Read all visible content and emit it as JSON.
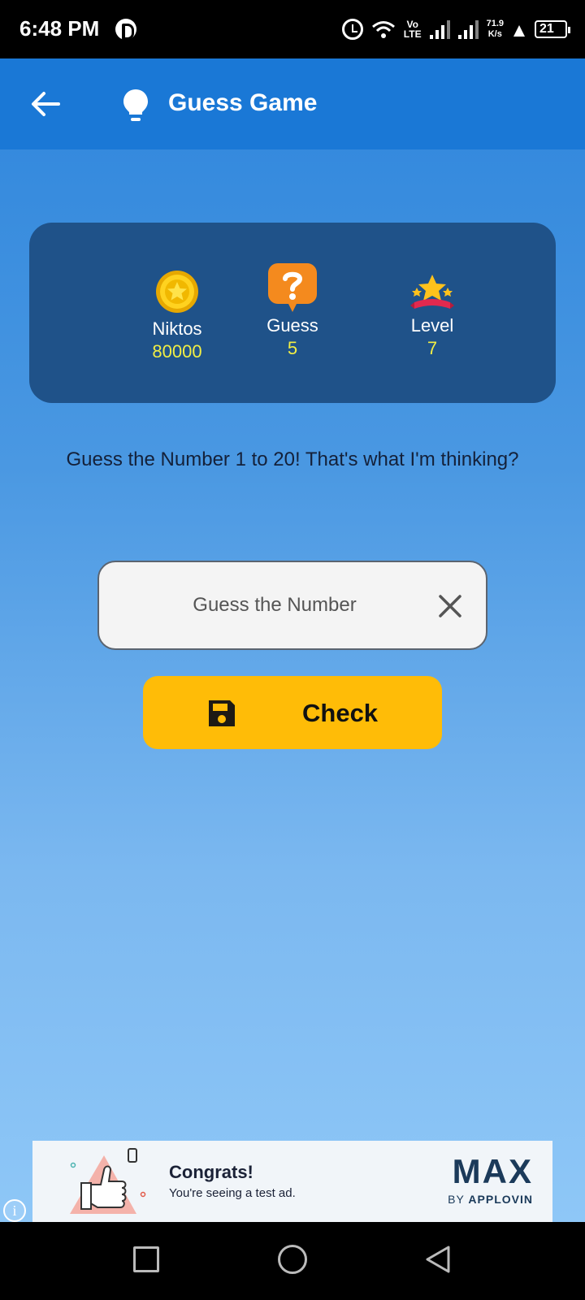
{
  "status_bar": {
    "time": "6:48 PM",
    "network": "Vo LTE",
    "network_line1": "Vo",
    "network_line2": "LTE",
    "speed_value": "71.9",
    "speed_unit": "K/s",
    "battery": "21"
  },
  "app_bar": {
    "title": "Guess Game",
    "back_icon": "arrow-left-icon",
    "title_icon": "lightbulb-icon"
  },
  "stats": [
    {
      "label": "Niktos",
      "value": "80000",
      "icon": "coin-star-icon"
    },
    {
      "label": "Guess",
      "value": "5",
      "icon": "question-bubble-icon"
    },
    {
      "label": "Level",
      "value": "7",
      "icon": "stars-ribbon-icon"
    }
  ],
  "prompt": "Guess the Number 1 to 20! That's what I'm thinking?",
  "guess_input": {
    "placeholder": "Guess the Number",
    "value": ""
  },
  "check_button": {
    "label": "Check",
    "icon": "save-icon"
  },
  "ad": {
    "title": "Congrats!",
    "subtitle": "You're seeing a test ad.",
    "brand": "MAX",
    "brand_sub_prefix": "BY ",
    "brand_sub_name": "APPLOVIN",
    "info_icon": "info-icon"
  },
  "colors": {
    "app_bar": "#1a78d6",
    "card": "#1f5289",
    "stat_value": "#f1ee44",
    "check_button": "#ffbc07"
  }
}
